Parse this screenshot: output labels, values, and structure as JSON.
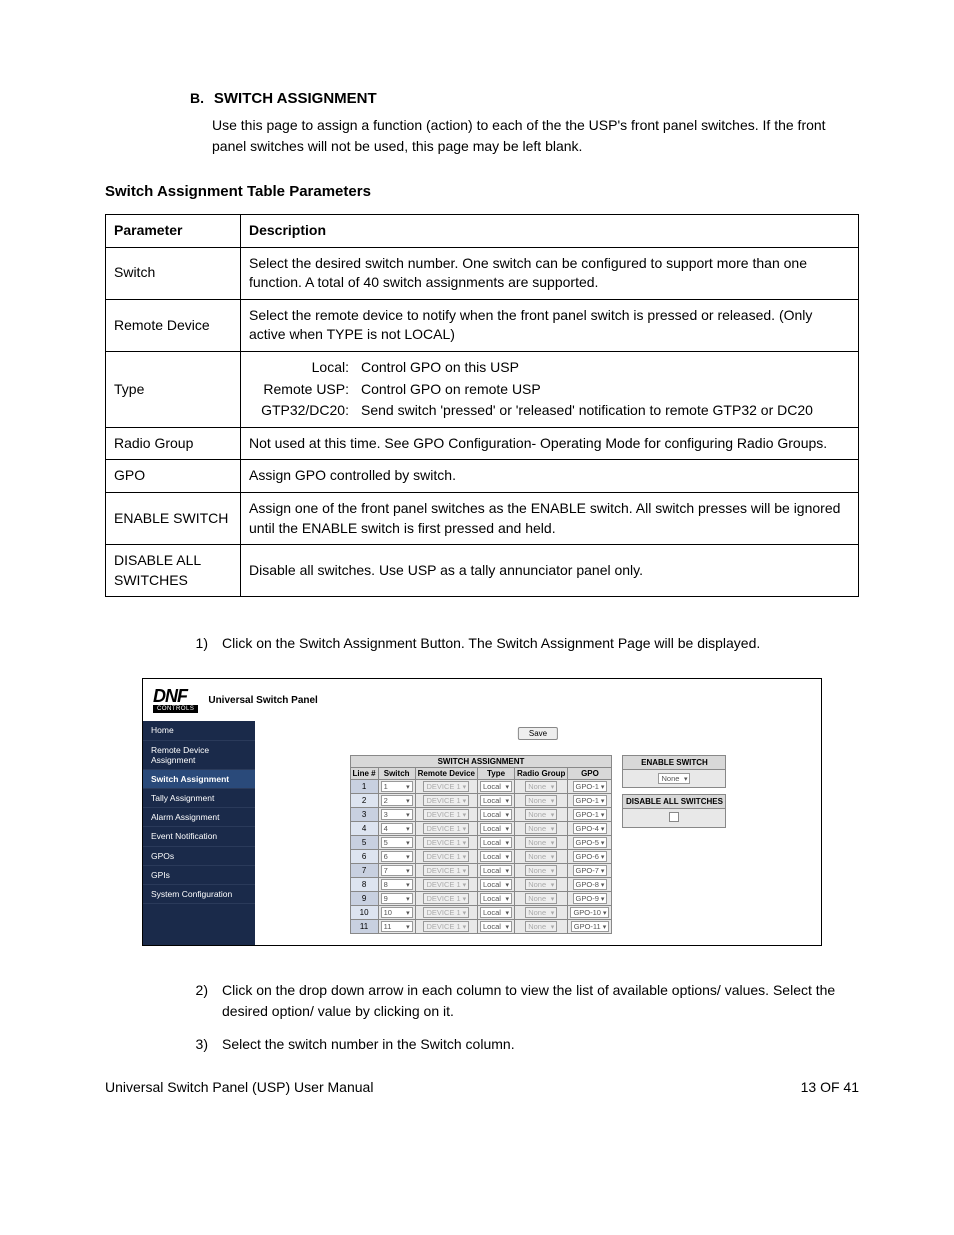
{
  "section": {
    "letter": "B.",
    "title": "SWITCH ASSIGNMENT",
    "desc": "Use this page to assign a function (action) to each of the the USP's front panel switches.  If the front panel switches will not be used, this page may be left blank."
  },
  "subheading": "Switch Assignment Table Parameters",
  "params_table": {
    "headers": [
      "Parameter",
      "Description"
    ],
    "rows": [
      {
        "p": "Switch",
        "d": "Select the desired switch number.  One switch can be configured to support more than one function.   A total of 40 switch assignments are supported."
      },
      {
        "p": "Remote Device",
        "d": "Select the remote device to notify when the front panel switch is pressed or released.  (Only active when TYPE is not LOCAL)"
      },
      {
        "p": "Type",
        "d_type": [
          {
            "k": "Local:",
            "v": "Control GPO on this USP"
          },
          {
            "k": "Remote USP:",
            "v": "Control GPO on remote USP"
          },
          {
            "k": "GTP32/DC20:",
            "v": "Send switch 'pressed' or 'released' notification to remote GTP32 or DC20"
          }
        ]
      },
      {
        "p": "Radio Group",
        "d": "Not used at this time.  See GPO Configuration- Operating Mode for configuring Radio Groups."
      },
      {
        "p": "GPO",
        "d": "Assign GPO controlled by switch."
      },
      {
        "p": "ENABLE SWITCH",
        "d": "Assign one of the front panel switches as the ENABLE switch.  All switch presses will be ignored until the ENABLE switch is first pressed and held."
      },
      {
        "p": "DISABLE ALL SWITCHES",
        "d": "Disable all switches.  Use USP as a tally annunciator panel only."
      }
    ]
  },
  "steps": [
    "Click on the Switch Assignment Button.  The Switch Assignment Page will be displayed.",
    "Click on the drop down arrow in each column to view the list of available options/ values.   Select the desired option/ value by clicking on it.",
    "Select the switch number in the Switch column."
  ],
  "app": {
    "logo_main": "DNF",
    "logo_sub": "CONTROLS",
    "logo_title": "Universal Switch Panel",
    "save": "Save",
    "sidebar": [
      "Home",
      "Remote Device Assignment",
      "Switch Assignment",
      "Tally Assignment",
      "Alarm Assignment",
      "Event Notification",
      "GPOs",
      "GPIs",
      "System Configuration"
    ],
    "sidebar_selected": "Switch Assignment",
    "table_title": "SWITCH ASSIGNMENT",
    "columns": [
      "Line #",
      "Switch",
      "Remote Device",
      "Type",
      "Radio Group",
      "GPO"
    ],
    "rows": [
      {
        "line": 1,
        "switch": "1",
        "remote": "DEVICE 1",
        "type": "Local",
        "radio": "None",
        "gpo": "GPO-1"
      },
      {
        "line": 2,
        "switch": "2",
        "remote": "DEVICE 1",
        "type": "Local",
        "radio": "None",
        "gpo": "GPO-1"
      },
      {
        "line": 3,
        "switch": "3",
        "remote": "DEVICE 1",
        "type": "Local",
        "radio": "None",
        "gpo": "GPO-1"
      },
      {
        "line": 4,
        "switch": "4",
        "remote": "DEVICE 1",
        "type": "Local",
        "radio": "None",
        "gpo": "GPO-4"
      },
      {
        "line": 5,
        "switch": "5",
        "remote": "DEVICE 1",
        "type": "Local",
        "radio": "None",
        "gpo": "GPO-5"
      },
      {
        "line": 6,
        "switch": "6",
        "remote": "DEVICE 1",
        "type": "Local",
        "radio": "None",
        "gpo": "GPO-6"
      },
      {
        "line": 7,
        "switch": "7",
        "remote": "DEVICE 1",
        "type": "Local",
        "radio": "None",
        "gpo": "GPO-7"
      },
      {
        "line": 8,
        "switch": "8",
        "remote": "DEVICE 1",
        "type": "Local",
        "radio": "None",
        "gpo": "GPO-8"
      },
      {
        "line": 9,
        "switch": "9",
        "remote": "DEVICE 1",
        "type": "Local",
        "radio": "None",
        "gpo": "GPO-9"
      },
      {
        "line": 10,
        "switch": "10",
        "remote": "DEVICE 1",
        "type": "Local",
        "radio": "None",
        "gpo": "GPO-10"
      },
      {
        "line": 11,
        "switch": "11",
        "remote": "DEVICE 1",
        "type": "Local",
        "radio": "None",
        "gpo": "GPO-11"
      }
    ],
    "enable_switch": {
      "title": "ENABLE SWITCH",
      "value": "None"
    },
    "disable_all": {
      "title": "DISABLE ALL SWITCHES"
    }
  },
  "footer": {
    "left": "Universal Switch Panel (USP) User Manual",
    "right": "13 OF 41"
  }
}
